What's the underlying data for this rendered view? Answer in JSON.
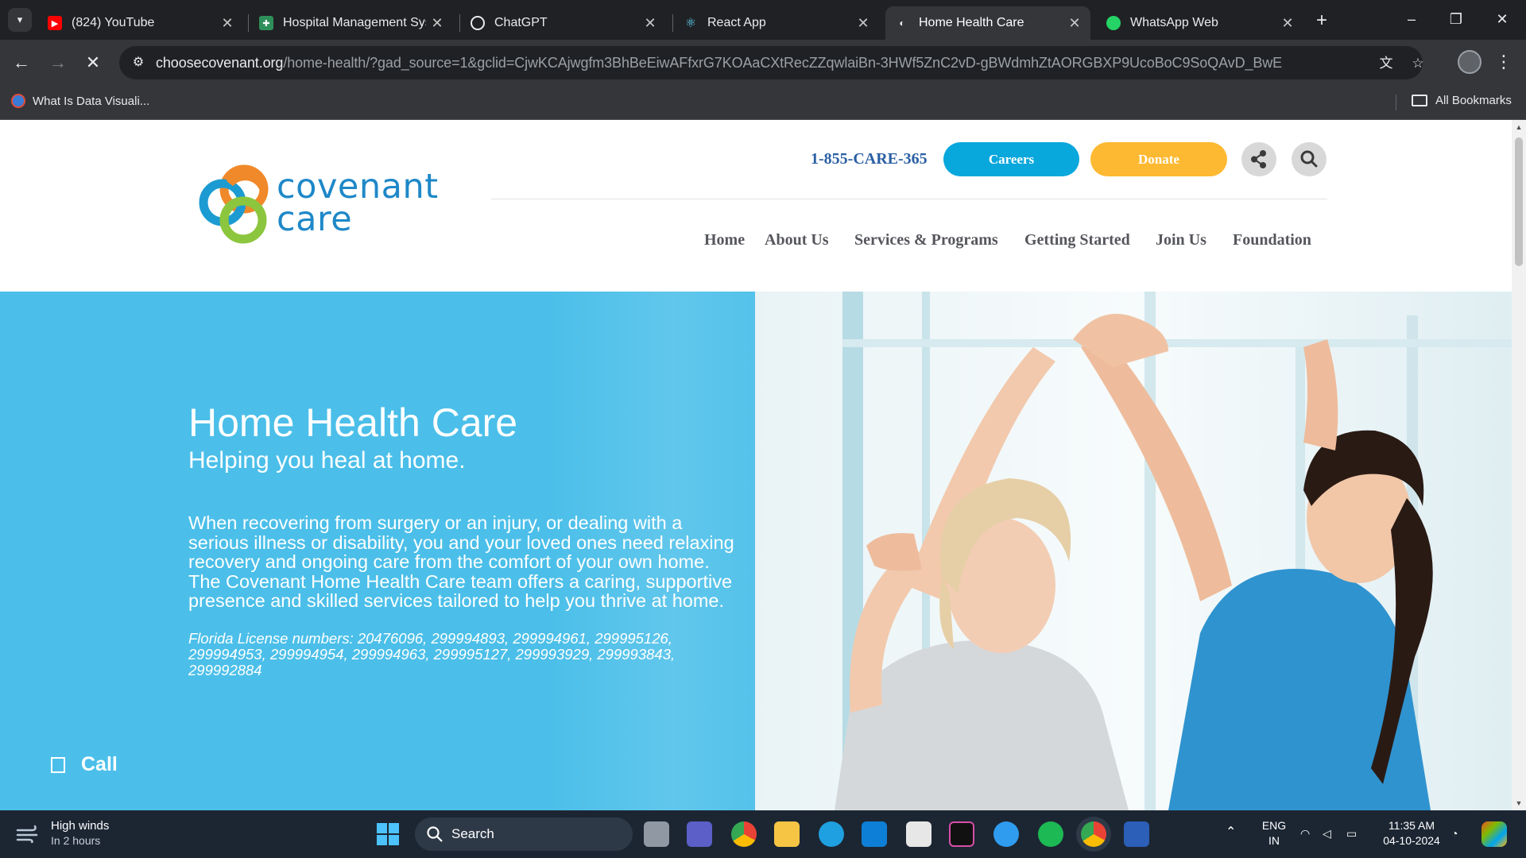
{
  "browser": {
    "tabs": [
      {
        "title": "(824) YouTube",
        "active": false
      },
      {
        "title": "Hospital Management Syst",
        "active": false
      },
      {
        "title": "ChatGPT",
        "active": false
      },
      {
        "title": "React App",
        "active": false
      },
      {
        "title": "Home Health Care",
        "active": true
      },
      {
        "title": "WhatsApp Web",
        "active": false
      }
    ],
    "url_host": "choosecovenant.org",
    "url_path": "/home-health/?gad_source=1&gclid=CjwKCAjwgfm3BhBeEiwAFfxrG7KOAaCXtRecZZqwlaiBn-3HWf5ZnC2vD-gBWdmhZtAORGBXP9UcoBoC9SoQAvD_BwE",
    "bookmarks": [
      {
        "label": "What Is Data Visuali..."
      }
    ],
    "all_bookmarks_label": "All Bookmarks",
    "window_controls": {
      "minimize": "–",
      "restore": "❐",
      "close": "✕"
    }
  },
  "site": {
    "logo_line1": "covenant",
    "logo_line2": "care",
    "phone": "1-855-CARE-365",
    "careers_label": "Careers",
    "donate_label": "Donate",
    "nav": [
      "Home",
      "About Us",
      "Services & Programs",
      "Getting Started",
      "Join Us",
      "Foundation"
    ],
    "colors": {
      "accent_blue": "#08a7dc",
      "donate_yellow": "#fdb931",
      "hero_blue": "#4bbfe9",
      "nav_text": "#55575c",
      "phone_text": "#2a5fa3"
    }
  },
  "hero": {
    "title": "Home Health Care",
    "subtitle": "Helping you heal at home.",
    "body": "When recovering from surgery or an injury, or dealing with a serious illness or disability, you and your loved ones need relaxing recovery and ongoing care from the comfort of your own home. The Covenant Home Health Care team  offers a caring, supportive presence and skilled services tailored to help you thrive at home.",
    "license": "Florida License numbers: 20476096, 299994893, 299994961, 299995126, 299994953, 299994954, 299994963, 299995127, 299993929, 299993843, 299992884",
    "call_label": "Call"
  },
  "taskbar": {
    "weather_title": "High winds",
    "weather_sub": "In 2 hours",
    "search_label": "Search",
    "lang_line1": "ENG",
    "lang_line2": "IN",
    "time": "11:35 AM",
    "date": "04-10-2024"
  }
}
